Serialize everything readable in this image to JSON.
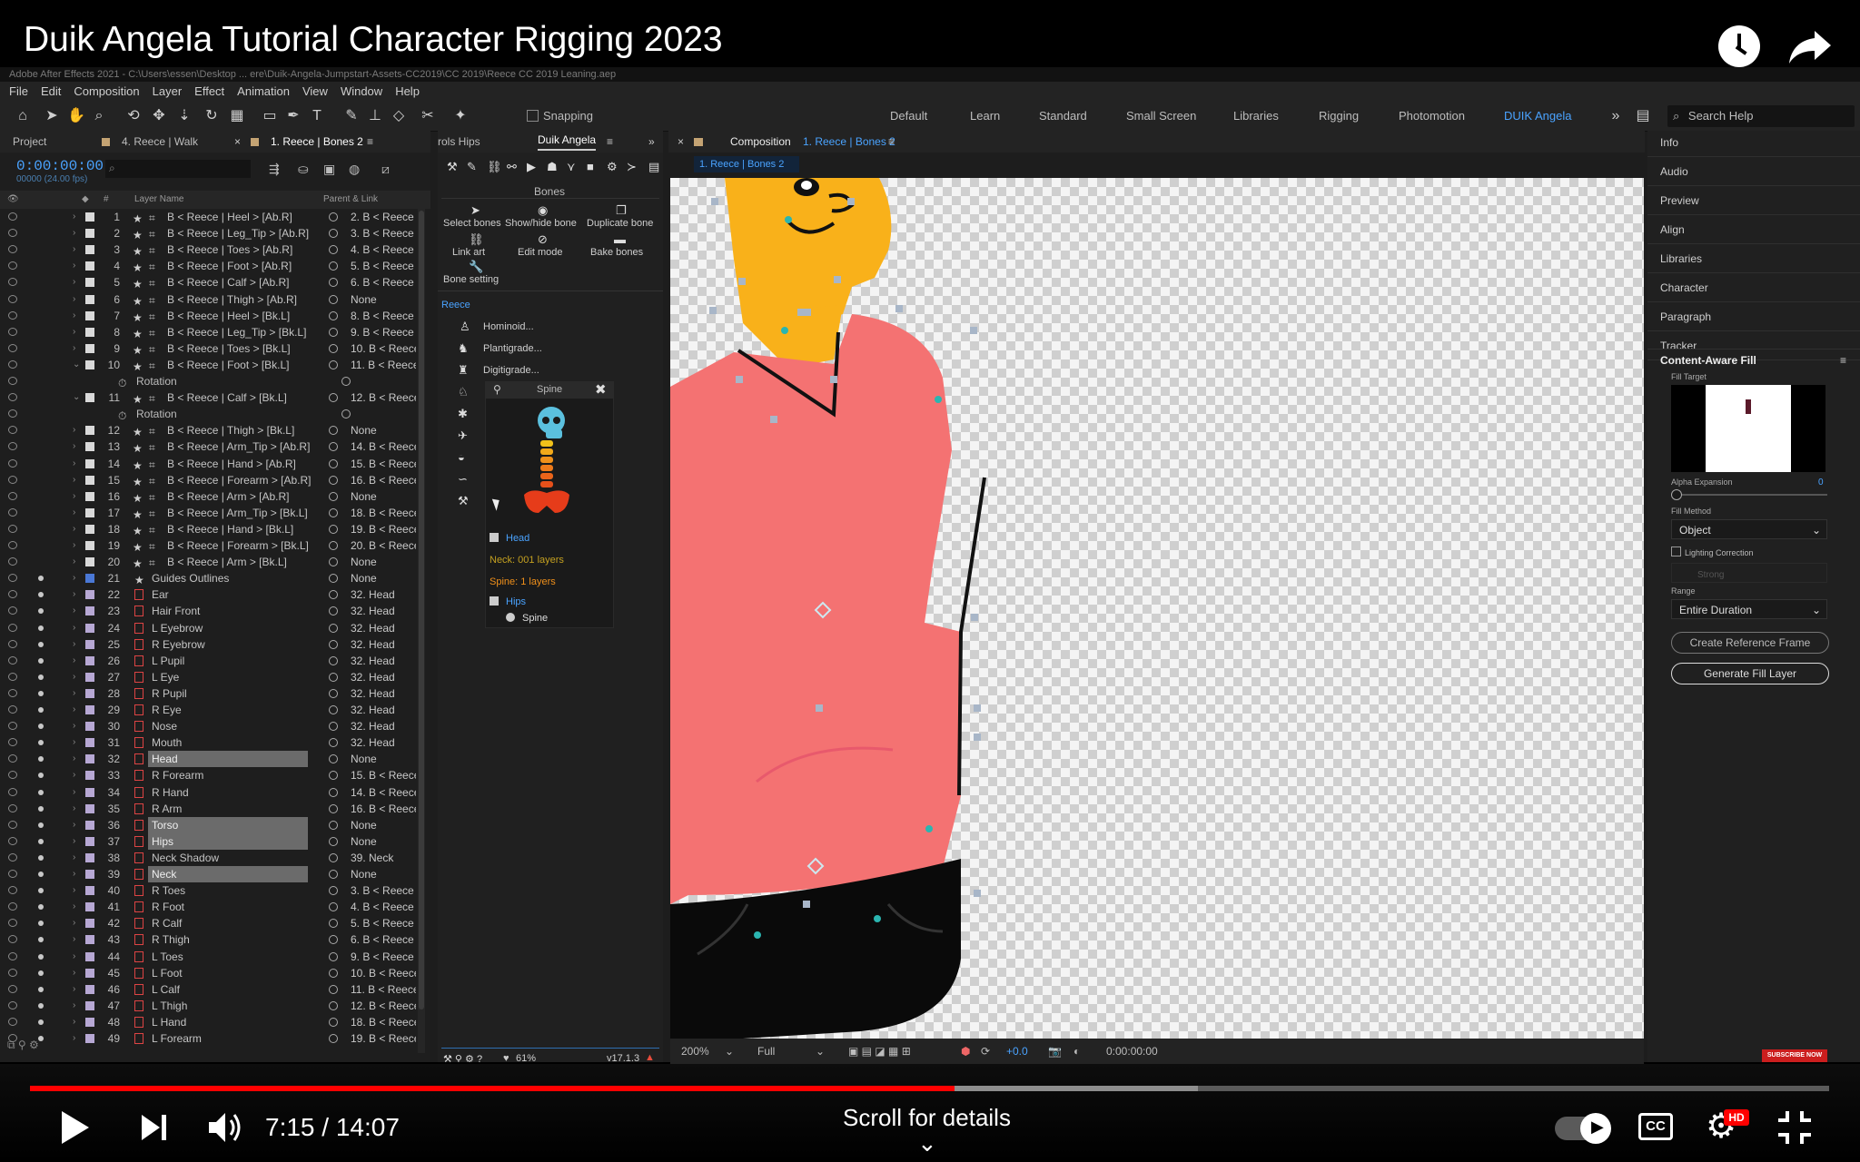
{
  "video": {
    "title": "Duik Angela Tutorial Character Rigging 2023",
    "time_current": "7:15",
    "time_separator": " / ",
    "time_total": "14:07",
    "scroll_hint": "Scroll for details",
    "progress_played": 0.514,
    "progress_buffered": 0.649,
    "subscribe_label": "SUBSCRIBE NOW",
    "hd_badge": "HD",
    "cc_label": "CC"
  },
  "ae": {
    "window_title": "Adobe After Effects 2021 - C:\\Users\\essen\\Desktop ... ere\\Duik-Angela-Jumpstart-Assets-CC2019\\CC 2019\\Reece CC 2019 Leaning.aep",
    "menu": [
      "File",
      "Edit",
      "Composition",
      "Layer",
      "Effect",
      "Animation",
      "View",
      "Window",
      "Help"
    ],
    "snapping_label": "Snapping",
    "workspaces": [
      "Default",
      "Learn",
      "Standard",
      "Small Screen",
      "Libraries",
      "Rigging",
      "Photomotion",
      "DUIK Angela"
    ],
    "active_workspace": "DUIK Angela",
    "search_placeholder": "Search Help"
  },
  "project_panel": {
    "tabs": [
      "Project",
      "4. Reece | Walk",
      "1. Reece | Bones 2"
    ],
    "timecode": "0:00:00:00",
    "fps": "00000 (24.00 fps)",
    "col_layer_name": "Layer Name",
    "col_parent": "Parent & Link",
    "layers": [
      {
        "num": "1",
        "name": "B < Reece | Heel > [Ab.R]",
        "parent": "2. B < Reece",
        "type": "bone"
      },
      {
        "num": "2",
        "name": "B < Reece | Leg_Tip > [Ab.R]",
        "parent": "3. B < Reece",
        "type": "bone"
      },
      {
        "num": "3",
        "name": "B < Reece | Toes > [Ab.R]",
        "parent": "4. B < Reece",
        "type": "bone"
      },
      {
        "num": "4",
        "name": "B < Reece | Foot > [Ab.R]",
        "parent": "5. B < Reece",
        "type": "bone"
      },
      {
        "num": "5",
        "name": "B < Reece | Calf > [Ab.R]",
        "parent": "6. B < Reece",
        "type": "bone"
      },
      {
        "num": "6",
        "name": "B < Reece | Thigh > [Ab.R]",
        "parent": "None",
        "type": "bone"
      },
      {
        "num": "7",
        "name": "B < Reece | Heel > [Bk.L]",
        "parent": "8. B < Reece",
        "type": "bone"
      },
      {
        "num": "8",
        "name": "B < Reece | Leg_Tip > [Bk.L]",
        "parent": "9. B < Reece",
        "type": "bone"
      },
      {
        "num": "9",
        "name": "B < Reece | Toes > [Bk.L]",
        "parent": "10. B < Reece",
        "type": "bone"
      },
      {
        "num": "10",
        "name": "B < Reece | Foot > [Bk.L]",
        "parent": "11. B < Reece",
        "type": "bone",
        "open": true
      },
      {
        "num": "",
        "name": "Rotation",
        "parent": "",
        "type": "prop"
      },
      {
        "num": "11",
        "name": "B < Reece | Calf > [Bk.L]",
        "parent": "12. B < Reece",
        "type": "bone",
        "open": true
      },
      {
        "num": "",
        "name": "Rotation",
        "parent": "",
        "type": "prop"
      },
      {
        "num": "12",
        "name": "B < Reece | Thigh > [Bk.L]",
        "parent": "None",
        "type": "bone"
      },
      {
        "num": "13",
        "name": "B < Reece | Arm_Tip > [Ab.R]",
        "parent": "14. B < Reece",
        "type": "bone"
      },
      {
        "num": "14",
        "name": "B < Reece | Hand > [Ab.R]",
        "parent": "15. B < Reece",
        "type": "bone"
      },
      {
        "num": "15",
        "name": "B < Reece | Forearm > [Ab.R]",
        "parent": "16. B < Reece",
        "type": "bone"
      },
      {
        "num": "16",
        "name": "B < Reece | Arm > [Ab.R]",
        "parent": "None",
        "type": "bone"
      },
      {
        "num": "17",
        "name": "B < Reece | Arm_Tip > [Bk.L]",
        "parent": "18. B < Reece",
        "type": "bone"
      },
      {
        "num": "18",
        "name": "B < Reece | Hand > [Bk.L]",
        "parent": "19. B < Reece",
        "type": "bone"
      },
      {
        "num": "19",
        "name": "B < Reece | Forearm > [Bk.L]",
        "parent": "20. B < Reece",
        "type": "bone"
      },
      {
        "num": "20",
        "name": "B < Reece | Arm > [Bk.L]",
        "parent": "None",
        "type": "bone"
      },
      {
        "num": "21",
        "name": "Guides Outlines",
        "parent": "None",
        "type": "guide"
      },
      {
        "num": "22",
        "name": "Ear",
        "parent": "32. Head",
        "type": "shape"
      },
      {
        "num": "23",
        "name": "Hair Front",
        "parent": "32. Head",
        "type": "shape"
      },
      {
        "num": "24",
        "name": "L Eyebrow",
        "parent": "32. Head",
        "type": "shape"
      },
      {
        "num": "25",
        "name": "R Eyebrow",
        "parent": "32. Head",
        "type": "shape"
      },
      {
        "num": "26",
        "name": "L Pupil",
        "parent": "32. Head",
        "type": "shape"
      },
      {
        "num": "27",
        "name": "L Eye",
        "parent": "32. Head",
        "type": "shape"
      },
      {
        "num": "28",
        "name": "R Pupil",
        "parent": "32. Head",
        "type": "shape"
      },
      {
        "num": "29",
        "name": "R Eye",
        "parent": "32. Head",
        "type": "shape"
      },
      {
        "num": "30",
        "name": "Nose",
        "parent": "32. Head",
        "type": "shape"
      },
      {
        "num": "31",
        "name": "Mouth",
        "parent": "32. Head",
        "type": "shape"
      },
      {
        "num": "32",
        "name": "Head",
        "parent": "None",
        "type": "shape",
        "selected": true
      },
      {
        "num": "33",
        "name": "R Forearm",
        "parent": "15. B < Reece",
        "type": "shape"
      },
      {
        "num": "34",
        "name": "R Hand",
        "parent": "14. B < Reece",
        "type": "shape"
      },
      {
        "num": "35",
        "name": "R Arm",
        "parent": "16. B < Reece",
        "type": "shape"
      },
      {
        "num": "36",
        "name": "Torso",
        "parent": "None",
        "type": "shape",
        "selected": true
      },
      {
        "num": "37",
        "name": "Hips",
        "parent": "None",
        "type": "shape",
        "selected": true
      },
      {
        "num": "38",
        "name": "Neck Shadow",
        "parent": "39. Neck",
        "type": "shape"
      },
      {
        "num": "39",
        "name": "Neck",
        "parent": "None",
        "type": "shape",
        "selected": true
      },
      {
        "num": "40",
        "name": "R Toes",
        "parent": "3. B < Reece",
        "type": "shape"
      },
      {
        "num": "41",
        "name": "R Foot",
        "parent": "4. B < Reece",
        "type": "shape"
      },
      {
        "num": "42",
        "name": "R Calf",
        "parent": "5. B < Reece",
        "type": "shape"
      },
      {
        "num": "43",
        "name": "R Thigh",
        "parent": "6. B < Reece",
        "type": "shape"
      },
      {
        "num": "44",
        "name": "L Toes",
        "parent": "9. B < Reece",
        "type": "shape"
      },
      {
        "num": "45",
        "name": "L Foot",
        "parent": "10. B < Reece",
        "type": "shape"
      },
      {
        "num": "46",
        "name": "L Calf",
        "parent": "11. B < Reece",
        "type": "shape"
      },
      {
        "num": "47",
        "name": "L Thigh",
        "parent": "12. B < Reece",
        "type": "shape"
      },
      {
        "num": "48",
        "name": "L Hand",
        "parent": "18. B < Reece",
        "type": "shape"
      },
      {
        "num": "49",
        "name": "L Forearm",
        "parent": "19. B < Reece",
        "type": "shape"
      }
    ]
  },
  "duik_panel": {
    "tabs": [
      "rols Hips",
      "Duik Angela"
    ],
    "section_bones": "Bones",
    "bone_tools": [
      "Select bones",
      "Show/hide bone",
      "Duplicate bone",
      "Link art",
      "Edit mode",
      "Bake bones",
      "Bone setting"
    ],
    "character_name": "Reece",
    "presets": [
      "Hominoid...",
      "Plantigrade...",
      "Digitigrade..."
    ],
    "spine_popup": {
      "title": "Spine",
      "head_label": "Head",
      "neck_label": "Neck: 001 layers",
      "spine_label": "Spine: 1 layers",
      "hips_label": "Hips",
      "spine_item": "Spine"
    },
    "footer_percent": "61%",
    "version": "v17.1.3"
  },
  "comp_panel": {
    "tab_label": "Composition",
    "tab_comp": "1. Reece | Bones 2",
    "breadcrumb": "1. Reece | Bones 2",
    "zoom": "200%",
    "resolution": "Full",
    "exposure": "+0.0",
    "timecode": "0:00:00:00"
  },
  "right_panel": {
    "items": [
      "Info",
      "Audio",
      "Preview",
      "Align",
      "Libraries",
      "Character",
      "Paragraph",
      "Tracker"
    ],
    "caf_title": "Content-Aware Fill",
    "fill_target_label": "Fill Target",
    "alpha_label": "Alpha Expansion",
    "alpha_value": "0",
    "fill_method_label": "Fill Method",
    "fill_method": "Object",
    "lighting_label": "Lighting Correction",
    "lighting_value": "Strong",
    "range_label": "Range",
    "range_value": "Entire Duration",
    "btn_reference": "Create Reference Frame",
    "btn_generate": "Generate Fill Layer"
  },
  "colors": {
    "accent_blue": "#4aa3ff",
    "progress_red": "#ff0000",
    "shirt": "#f47272",
    "skin": "#f9b11a",
    "pants": "#0a0a0a"
  }
}
